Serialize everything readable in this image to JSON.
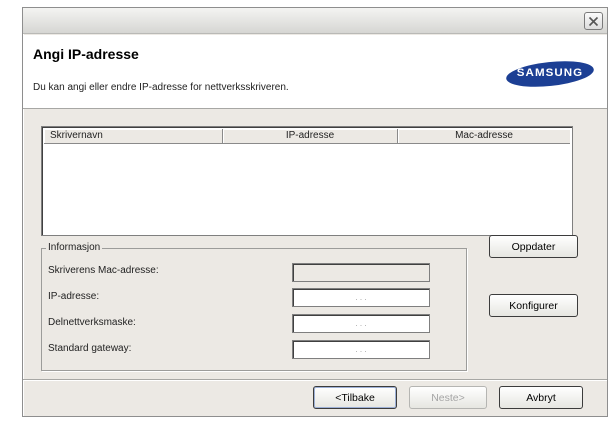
{
  "window": {
    "close_icon": "close-icon"
  },
  "header": {
    "title": "Angi IP-adresse",
    "description": "Du kan angi eller endre IP-adresse for nettverksskriveren.",
    "logo_text": "SAMSUNG",
    "logo_color": "#1c3f94"
  },
  "printer_list": {
    "columns": [
      "Skrivernavn",
      "IP-adresse",
      "Mac-adresse"
    ],
    "rows": []
  },
  "info_group": {
    "legend": "Informasjon",
    "fields": [
      {
        "label": "Skriverens Mac-adresse:",
        "value": "",
        "enabled": false
      },
      {
        "label": "IP-adresse:",
        "value": ". . .",
        "enabled": true
      },
      {
        "label": "Delnettverksmaske:",
        "value": ". . .",
        "enabled": true
      },
      {
        "label": "Standard gateway:",
        "value": ". . .",
        "enabled": true
      }
    ]
  },
  "buttons": {
    "update": "Oppdater",
    "configure": "Konfigurer",
    "back": "<Tilbake",
    "next": "Neste>",
    "cancel": "Avbryt"
  }
}
